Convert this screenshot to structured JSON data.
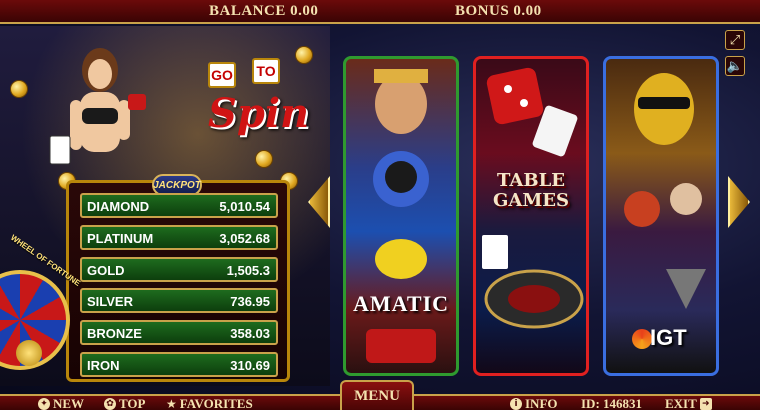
{
  "header": {
    "balance": "BALANCE 0.00",
    "bonus": "BONUS 0.00"
  },
  "promo": {
    "go": "GO",
    "to": "TO",
    "spin": "Spin"
  },
  "jackpot": {
    "badge": "JACKPOT",
    "levels": [
      {
        "label": "DIAMOND",
        "value": "5,010.54"
      },
      {
        "label": "PLATINUM",
        "value": "3,052.68"
      },
      {
        "label": "GOLD",
        "value": "1,505.3"
      },
      {
        "label": "SILVER",
        "value": "736.95"
      },
      {
        "label": "BRONZE",
        "value": "358.03"
      },
      {
        "label": "IRON",
        "value": "310.69"
      }
    ]
  },
  "wheel": {
    "label": "WHEEL OF FORTUNE"
  },
  "providers": [
    {
      "title": "AMATIC"
    },
    {
      "title": "TABLE GAMES"
    },
    {
      "title": "IGT"
    }
  ],
  "footer": {
    "new": "NEW",
    "top": "TOP",
    "favorites": "FAVORITES",
    "menu": "MENU",
    "info": "INFO",
    "id": "ID: 146831",
    "exit": "EXIT"
  },
  "icons": {
    "fullscreen": "fullscreen-icon",
    "sound": "speaker-icon"
  },
  "colors": {
    "bar": "#6b0a0a",
    "gold": "#c9a24a",
    "jackpot_row": "#1e6b1e"
  }
}
